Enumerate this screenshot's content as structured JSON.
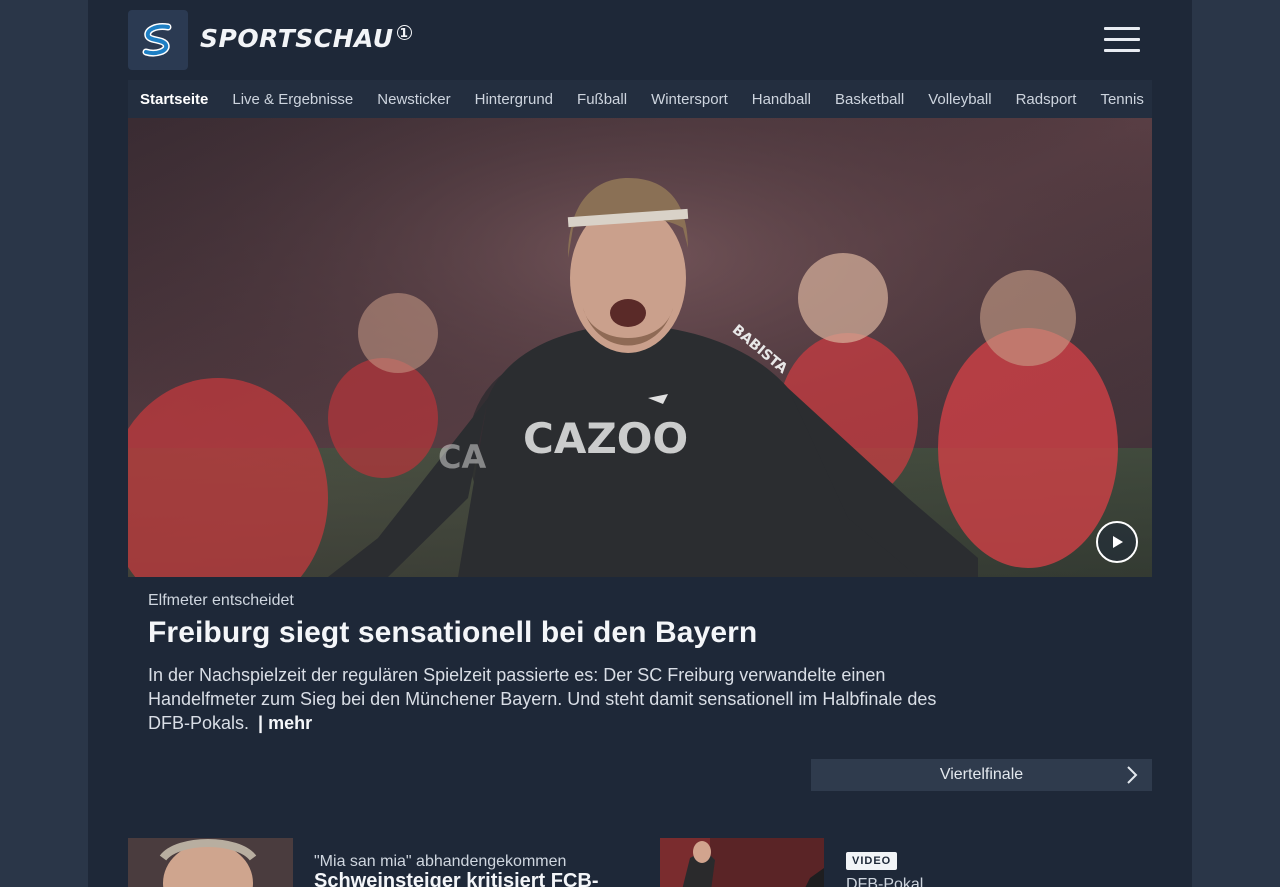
{
  "header": {
    "brand": "SPORTSCHAU",
    "brand_mark": "1",
    "menu_icon": "hamburger-menu-icon"
  },
  "nav": {
    "items": [
      {
        "label": "Startseite",
        "active": true
      },
      {
        "label": "Live & Ergebnisse"
      },
      {
        "label": "Newsticker"
      },
      {
        "label": "Hintergrund"
      },
      {
        "label": "Fußball"
      },
      {
        "label": "Wintersport"
      },
      {
        "label": "Handball"
      },
      {
        "label": "Basketball"
      },
      {
        "label": "Volleyball"
      },
      {
        "label": "Radsport"
      },
      {
        "label": "Tennis"
      }
    ]
  },
  "hero": {
    "kicker": "Elfmeter entscheidet",
    "headline": "Freiburg siegt sensationell bei den Bayern",
    "teaser": "In der Nachspielzeit der regulären Spielzeit passierte es: Der SC Freiburg verwandelte einen Handelfmeter zum Sieg bei den Münchener Bayern. Und steht damit sensationell im Halbfinale des DFB-Pokals.",
    "more_label": "| mehr",
    "play_icon": "play-icon",
    "jersey_text": "CAZOO",
    "jersey_text_left": "CA",
    "sleeve_text": "BABISTA"
  },
  "topic_link": {
    "label": "Viertelfinale",
    "icon": "chevron-right-icon"
  },
  "cards": [
    {
      "kicker": "\"Mia san mia\" abhandengekommen",
      "title": "Schweinsteiger kritisiert FCB-"
    },
    {
      "badge": "VIDEO",
      "kicker": "DFB-Pokal"
    }
  ],
  "colors": {
    "background": "#2a3648",
    "page": "#1e2838",
    "nav": "#232e3f",
    "button": "#2f3b4d",
    "text": "#f4f6f9",
    "logo_blue": "#1e7fc4"
  }
}
